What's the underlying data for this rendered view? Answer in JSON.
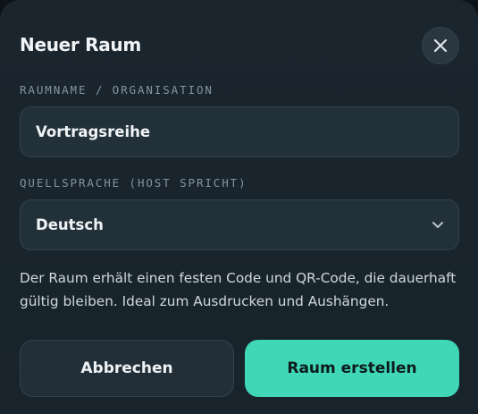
{
  "dialog": {
    "title": "Neuer Raum",
    "close_icon": "close-icon"
  },
  "room_name": {
    "label": "RAUMNAME / ORGANISATION",
    "value": "Vortragsreihe"
  },
  "source_language": {
    "label": "QUELLSPRACHE (HOST SPRICHT)",
    "selected": "Deutsch",
    "icon": "chevron-down-icon"
  },
  "hint": "Der Raum erhält einen festen Code und QR-Code, die dauerhaft gültig bleiben. Ideal zum Ausdrucken und Aushängen.",
  "actions": {
    "cancel_label": "Abbrechen",
    "create_label": "Raum erstellen"
  },
  "colors": {
    "background": "#1a252e",
    "field": "#223039",
    "accent": "#3fd7b6",
    "label": "#8593a0"
  }
}
